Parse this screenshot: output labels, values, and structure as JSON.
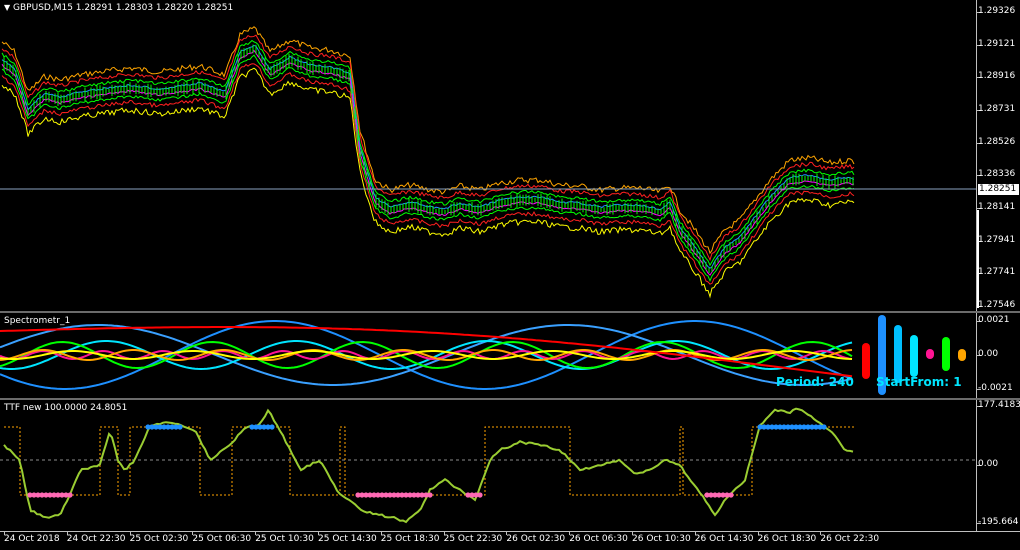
{
  "main": {
    "title": "GBPUSD,M15  1.28291 1.28303 1.28220 1.28251",
    "price_scale": [
      "1.29326",
      "1.29121",
      "1.28916",
      "1.28731",
      "1.28526",
      "1.28336",
      "1.28141",
      "1.27941",
      "1.27741",
      "1.27546"
    ],
    "current_price": "1.28251"
  },
  "spectrometr": {
    "title": "Spectrometr_1",
    "scale": [
      "0.0021",
      "0.00",
      "-0.0021"
    ],
    "period_label": "Period: 240",
    "start_label": "StartFrom: 1",
    "bar_colors": [
      "#ff0000",
      "#1e90ff",
      "#00bfff",
      "#00e5ff",
      "#ff1493",
      "#00ff00",
      "#ffa500"
    ]
  },
  "ttf": {
    "title": "TTF new 100.0000 24.8051",
    "scale": [
      "177.4183",
      "0.00",
      "-195.664"
    ]
  },
  "time_axis": [
    "24 Oct 2018",
    "24 Oct 22:30",
    "25 Oct 02:30",
    "25 Oct 06:30",
    "25 Oct 10:30",
    "25 Oct 14:30",
    "25 Oct 18:30",
    "25 Oct 22:30",
    "26 Oct 02:30",
    "26 Oct 06:30",
    "26 Oct 10:30",
    "26 Oct 14:30",
    "26 Oct 18:30",
    "26 Oct 22:30"
  ],
  "colors": {
    "background": "#000000",
    "price": "#00ff00",
    "envelope_upper": "#ffff00",
    "envelope_red": "#ff2020",
    "envelope_blue": "#1e90ff",
    "ttf_line": "#9acd32",
    "ttf_signal": "#ffa500",
    "ttf_bull": "#1e90ff",
    "ttf_bear": "#ff69b4"
  }
}
